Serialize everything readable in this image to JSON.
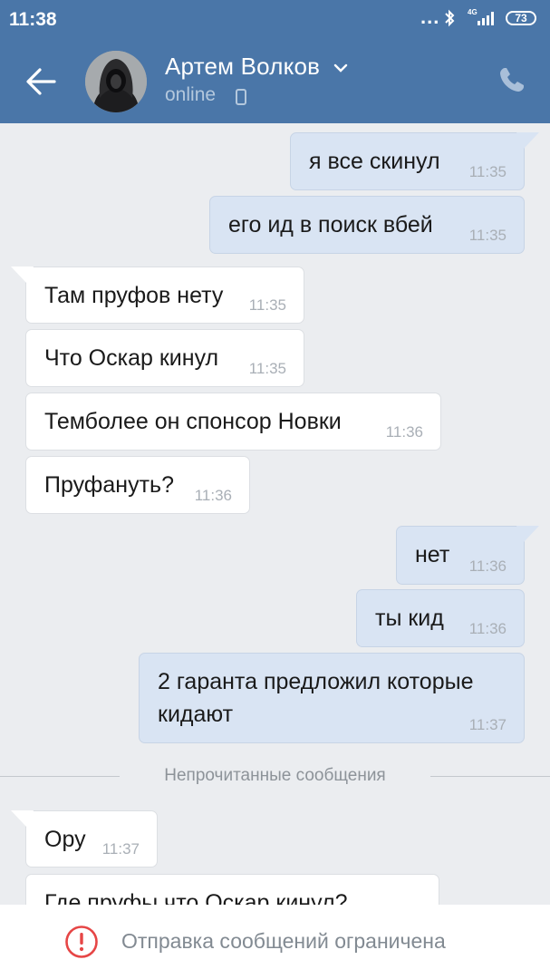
{
  "status_bar": {
    "time": "11:38",
    "dots": "...",
    "network": "4G",
    "battery": "73"
  },
  "header": {
    "contact_name": "Артем Волков",
    "status": "online"
  },
  "messages": [
    {
      "dir": "out",
      "text": "я все скинул",
      "time": "11:35"
    },
    {
      "dir": "out",
      "text": "его ид в поиск вбей",
      "time": "11:35"
    },
    {
      "dir": "in",
      "text": "Там пруфов нету",
      "time": "11:35"
    },
    {
      "dir": "in",
      "text": "Что Оскар кинул",
      "time": "11:35"
    },
    {
      "dir": "in",
      "text": "Темболее он спонсор Новки",
      "time": "11:36"
    },
    {
      "dir": "in",
      "text": "Пруфануть?",
      "time": "11:36"
    },
    {
      "dir": "out",
      "text": "нет",
      "time": "11:36"
    },
    {
      "dir": "out",
      "text": "ты кид",
      "time": "11:36"
    },
    {
      "dir": "out",
      "text": "2 гаранта предложил которые",
      "text2": "кидают",
      "time": "11:37"
    },
    {
      "dir": "in",
      "text": "Ору",
      "time": "11:37"
    },
    {
      "dir": "in",
      "text": "Где пруфы что Оскар кинул?",
      "time": ""
    }
  ],
  "divider_label": "Непрочитанные сообщения",
  "bottom_notice": "Отправка сообщений ограничена",
  "colors": {
    "header": "#4a76a8",
    "background": "#ebedf0",
    "outgoing_bubble": "#d9e4f3",
    "incoming_bubble": "#ffffff",
    "warning": "#e64646"
  },
  "icons": [
    "back-arrow-icon",
    "chevron-down-icon",
    "mobile-phone-icon",
    "call-icon",
    "warning-icon",
    "bluetooth-icon",
    "signal-icon",
    "battery-icon"
  ]
}
